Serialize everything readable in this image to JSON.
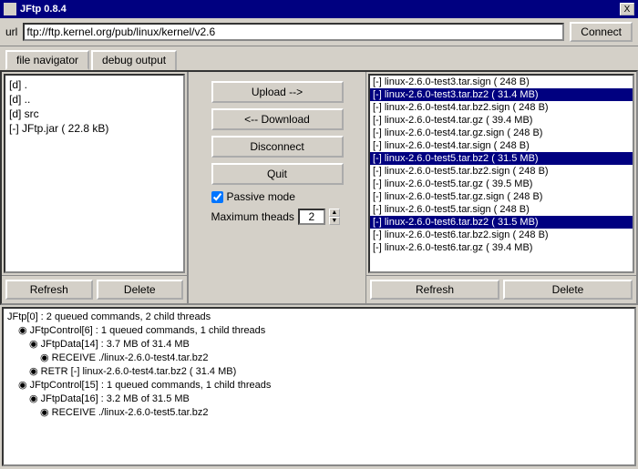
{
  "titleBar": {
    "title": "JFtp 0.8.4",
    "closeLabel": "X"
  },
  "urlBar": {
    "label": "url",
    "value": "ftp://ftp.kernel.org/pub/linux/kernel/v2.6",
    "connectLabel": "Connect"
  },
  "tabs": [
    {
      "id": "file-navigator",
      "label": "file navigator",
      "active": true
    },
    {
      "id": "debug-output",
      "label": "debug output",
      "active": false
    }
  ],
  "leftPanel": {
    "files": [
      {
        "label": "[d] ."
      },
      {
        "label": "[d] .."
      },
      {
        "label": "[d] src"
      },
      {
        "label": "[-] JFtp.jar  ( 22.8 kB)"
      }
    ],
    "refreshLabel": "Refresh",
    "deleteLabel": "Delete"
  },
  "controls": {
    "uploadLabel": "Upload -->",
    "downloadLabel": "<-- Download",
    "disconnectLabel": "Disconnect",
    "quitLabel": "Quit",
    "passiveModeLabel": "Passive mode",
    "maxThreadsLabel": "Maximum theads",
    "maxThreadsValue": "2"
  },
  "rightPanel": {
    "files": [
      {
        "label": "[-] linux-2.6.0-test3.tar.sign  ( 248 B)",
        "selected": false
      },
      {
        "label": "[-] linux-2.6.0-test3.tar.bz2  ( 31.4 MB)",
        "selected": true
      },
      {
        "label": "[-] linux-2.6.0-test4.tar.bz2.sign  ( 248 B)",
        "selected": false
      },
      {
        "label": "[-] linux-2.6.0-test4.tar.gz  ( 39.4 MB)",
        "selected": false
      },
      {
        "label": "[-] linux-2.6.0-test4.tar.gz.sign  ( 248 B)",
        "selected": false
      },
      {
        "label": "[-] linux-2.6.0-test4.tar.sign  ( 248 B)",
        "selected": false
      },
      {
        "label": "[-] linux-2.6.0-test5.tar.bz2  ( 31.5 MB)",
        "selected": true
      },
      {
        "label": "[-] linux-2.6.0-test5.tar.bz2.sign  ( 248 B)",
        "selected": false
      },
      {
        "label": "[-] linux-2.6.0-test5.tar.gz  ( 39.5 MB)",
        "selected": false
      },
      {
        "label": "[-] linux-2.6.0-test5.tar.gz.sign  ( 248 B)",
        "selected": false
      },
      {
        "label": "[-] linux-2.6.0-test5.tar.sign  ( 248 B)",
        "selected": false
      },
      {
        "label": "[-] linux-2.6.0-test6.tar.bz2  ( 31.5 MB)",
        "selected": true
      },
      {
        "label": "[-] linux-2.6.0-test6.tar.bz2.sign  ( 248 B)",
        "selected": false
      },
      {
        "label": "[-] linux-2.6.0-test6.tar.gz  ( 39.4 MB)",
        "selected": false
      }
    ],
    "refreshLabel": "Refresh",
    "deleteLabel": "Delete"
  },
  "debugLog": {
    "entries": [
      {
        "indent": 0,
        "type": "root",
        "label": "JFtp[0] : 2 queued commands, 2 child threads"
      },
      {
        "indent": 1,
        "type": "folder",
        "label": "JFtpControl[6] : 1 queued commands, 1 child threads"
      },
      {
        "indent": 2,
        "type": "folder",
        "label": "JFtpData[14] : 3.7 MB of 31.4 MB"
      },
      {
        "indent": 3,
        "type": "file",
        "label": "RECEIVE ./linux-2.6.0-test4.tar.bz2"
      },
      {
        "indent": 2,
        "type": "file",
        "label": "RETR [-] linux-2.6.0-test4.tar.bz2  ( 31.4 MB)"
      },
      {
        "indent": 1,
        "type": "folder",
        "label": "JFtpControl[15] : 1 queued commands, 1 child threads"
      },
      {
        "indent": 2,
        "type": "folder",
        "label": "JFtpData[16] : 3.2 MB of 31.5 MB"
      },
      {
        "indent": 3,
        "type": "file",
        "label": "RECEIVE ./linux-2.6.0-test5.tar.bz2"
      }
    ]
  }
}
